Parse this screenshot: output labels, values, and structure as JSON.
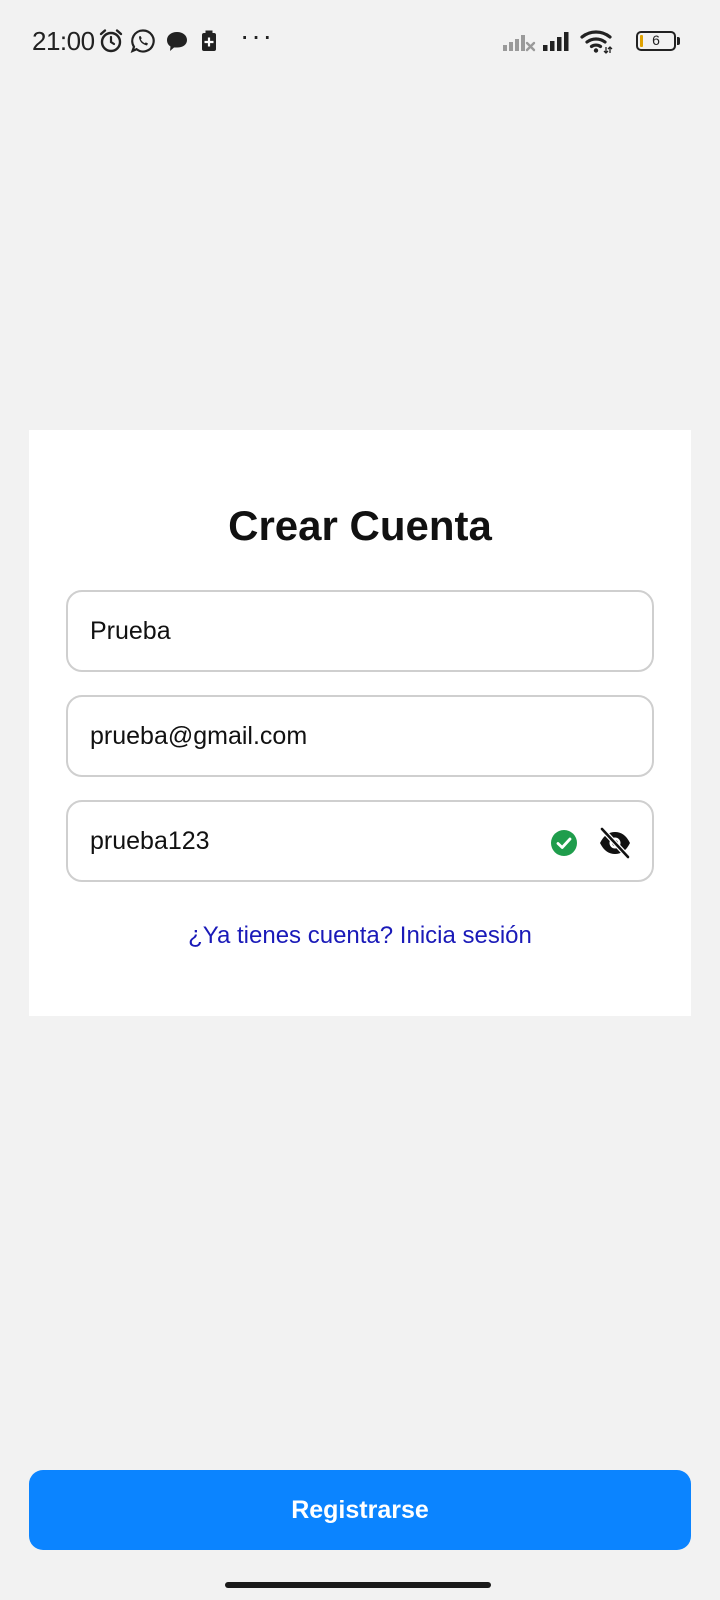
{
  "status_bar": {
    "time": "21:00",
    "battery_level": "6",
    "icons": [
      "alarm-icon",
      "whatsapp-icon",
      "chat-bubble-icon",
      "battery-saver-icon",
      "more-dots-icon",
      "signal-no-service-icon",
      "signal-icon",
      "wifi-icon",
      "battery-icon"
    ],
    "more_dots": "···"
  },
  "card": {
    "title": "Crear Cuenta",
    "name_field": {
      "value": "Prueba"
    },
    "email_field": {
      "value": "prueba@gmail.com"
    },
    "password_field": {
      "value": "prueba123"
    },
    "login_link": "¿Ya tienes cuenta? Inicia sesión"
  },
  "actions": {
    "register_label": "Registrarse"
  },
  "colors": {
    "background": "#f2f2f2",
    "card": "#ffffff",
    "primary": "#0b84ff",
    "link": "#1a1ab8",
    "valid": "#1f9d4c"
  }
}
